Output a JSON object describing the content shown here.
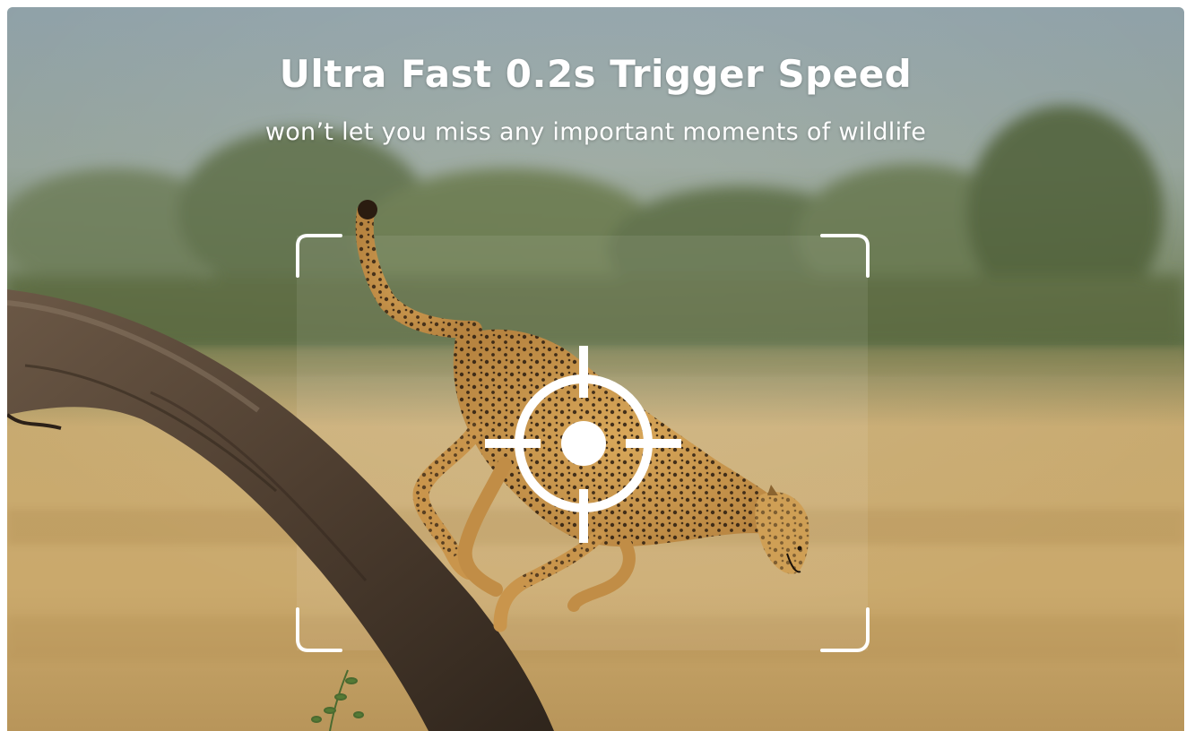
{
  "banner": {
    "headline": "Ultra Fast 0.2s Trigger Speed",
    "subheadline": "won’t let you miss any important moments of wildlife"
  },
  "photo": {
    "subject": "cheetah-on-tree-branch",
    "overlay_icons": [
      "viewfinder-frame-icon",
      "crosshair-target-icon"
    ]
  },
  "colors": {
    "text": "#ffffff",
    "sky_top": "#8fa3ab",
    "grass": "#c9a86b",
    "foliage": "#5a7040",
    "trunk": "#4a3a2c"
  }
}
